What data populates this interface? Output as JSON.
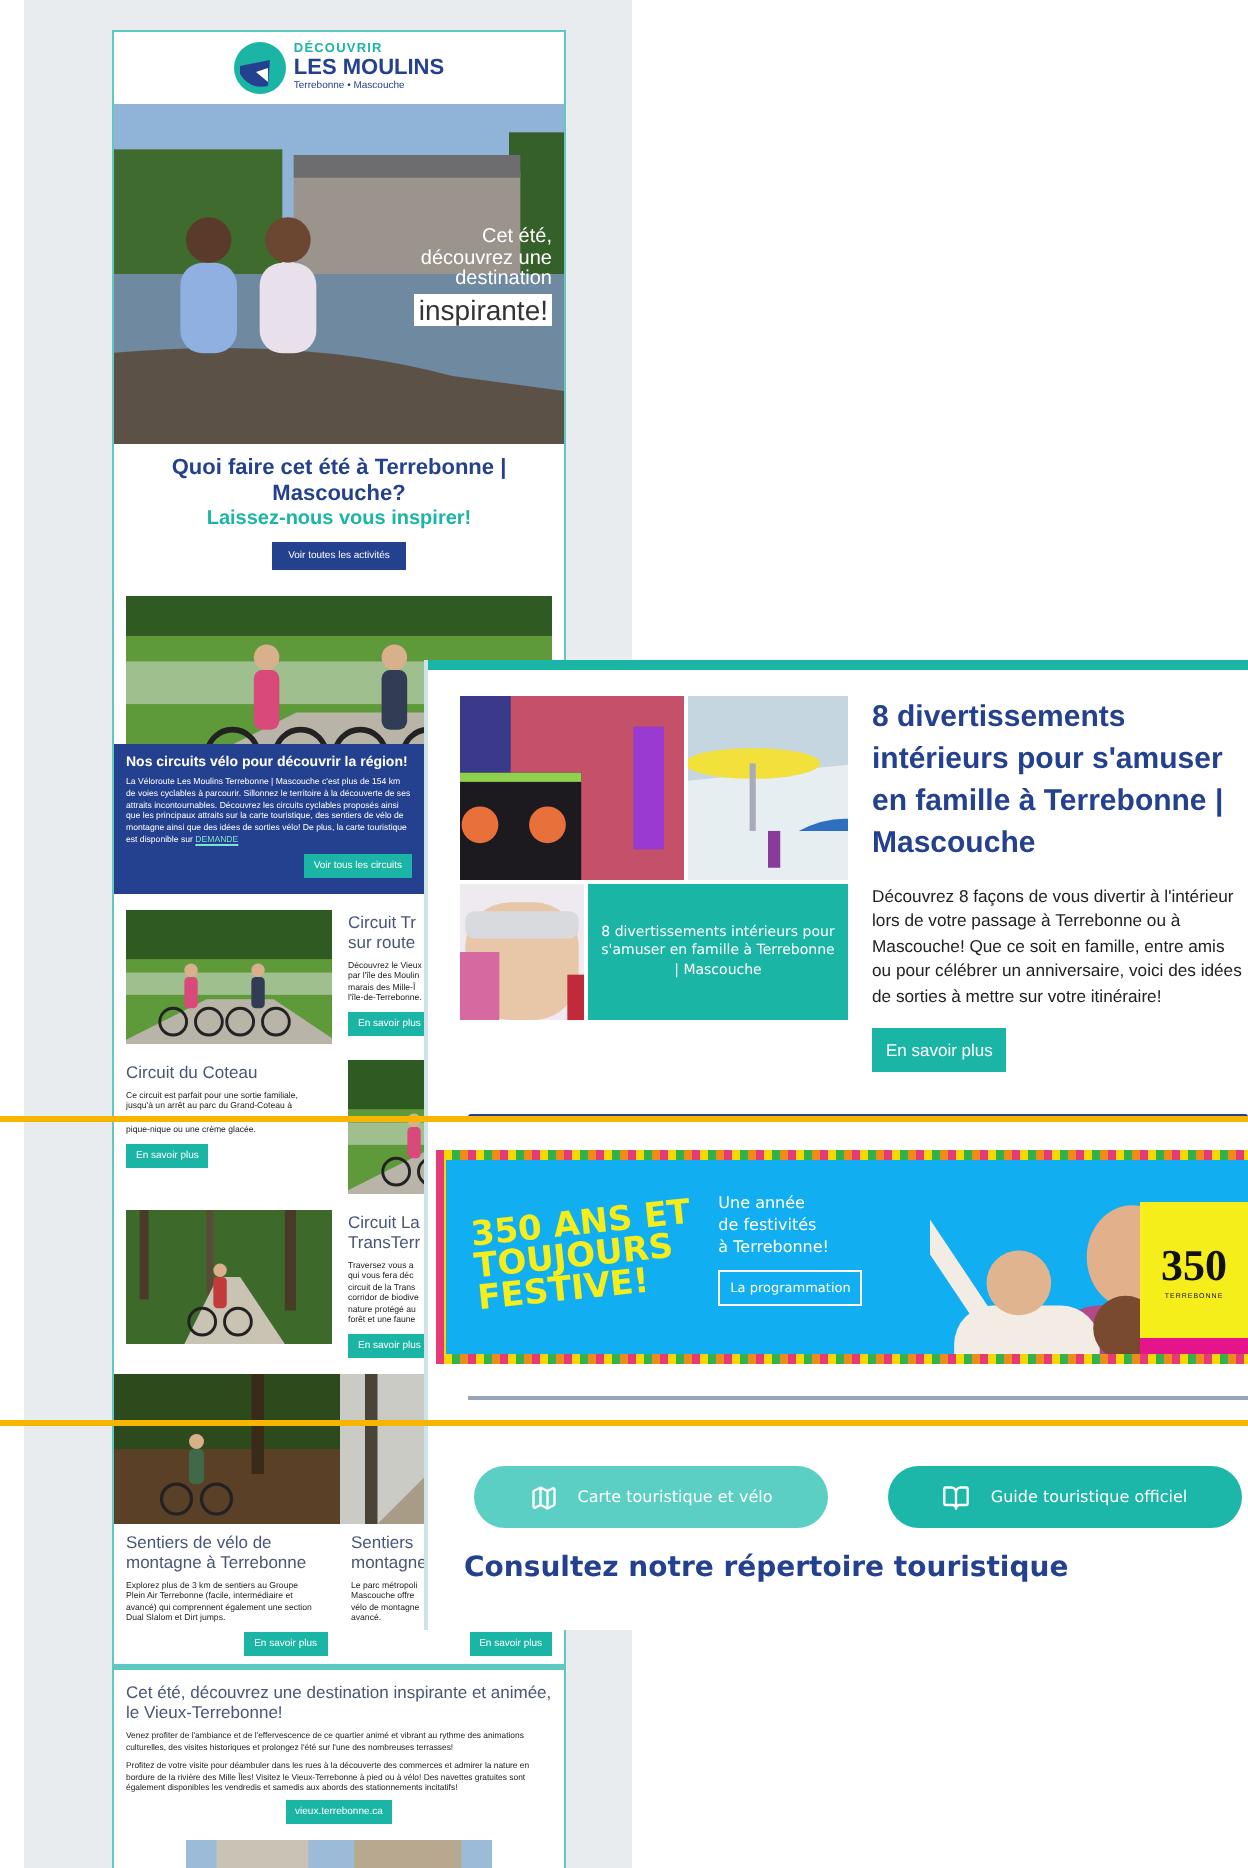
{
  "email": {
    "logo": {
      "top": "DÉCOUVRIR",
      "main": "LES MOULINS",
      "sub": "Terrebonne • Mascouche"
    },
    "hero": {
      "lines": [
        "Cet été,",
        "découvrez une",
        "destination"
      ],
      "highlight": "inspirante!"
    },
    "intro": {
      "title": "Quoi faire cet été à Terrebonne | Mascouche?",
      "subtitle": "Laissez-nous vous inspirer!",
      "button": "Voir toutes les activités"
    },
    "bike": {
      "title": "Nos circuits vélo pour découvrir la région!",
      "text": "La Véloroute Les Moulins Terrebonne | Mascouche c'est plus de 154 km de voies cyclables à parcourir. Sillonnez le territoire à la découverte de ses attraits incontournables. Découvrez les circuits cyclables proposés ainsi que les principaux attraits sur la carte touristique, des sentiers de vélo de montagne ainsi que des idées de sorties vélo! De plus, la carte touristique est disponible sur",
      "link": "DEMANDE",
      "button": "Voir tous les circuits"
    },
    "rows": [
      {
        "kind": "image-left",
        "title": [
          "Circuit Tr",
          "sur route"
        ],
        "text": [
          "Découvrez le Vieux",
          "par l'île des Moulin",
          "marais des Mille-Î",
          "l'île-de-Terrebonne."
        ],
        "button": "En savoir plus"
      },
      {
        "kind": "image-right",
        "title": [
          "Circuit du Coteau"
        ],
        "text": [
          "Ce circuit est parfait pour une sortie familiale,",
          "jusqu'à un arrêt au parc du Grand-Coteau à",
          "pique-nique ou une crème glacée."
        ],
        "button": "En savoir plus"
      },
      {
        "kind": "image-left",
        "title": [
          "Circuit La",
          "TransTerr"
        ],
        "text": [
          "Traversez vous a",
          "qui vous fera déc",
          "circuit de la Trans",
          "corridor de biodive",
          "nature protégé au",
          "forêt et une faune"
        ],
        "button": "En savoir plus"
      }
    ],
    "mountain": [
      {
        "title": [
          "Sentiers de vélo de",
          "montagne à Terrebonne"
        ],
        "text": [
          "Explorez plus de 3 km de sentiers au Groupe",
          "Plein Air Terrebonne (facile, intermédiaire et",
          "avancé) qui comprennent également une section",
          "Dual Slalom et Dirt jumps."
        ],
        "button": "En savoir plus"
      },
      {
        "title": [
          "Sentiers",
          "montagne"
        ],
        "text": [
          "Le parc métropoli",
          "Mascouche offre",
          "vélo de montagne",
          "avancé."
        ],
        "button": "En savoir plus"
      }
    ],
    "village": {
      "title": "Cet été, découvrez une destination inspirante et animée, le Vieux-Terrebonne!",
      "paragraphs": [
        "Venez profiter de l'ambiance et de l'effervescence de ce quartier animé et vibrant au rythme des animations culturelles, des visites historiques et prolongez l'été sur l'une des nombreuses terrasses!",
        "Profitez de votre visite pour déambuler dans les rues à la découverte des commerces et admirer la nature en bordure de la rivière des Mille Îles! Visitez le Vieux-Terrebonne à pied ou à vélo! Des navettes gratuites sont également disponibles les vendredis et samedis aux abords des stationnements incitatifs!"
      ],
      "button": "vieux.terrebonne.ca"
    }
  },
  "overlay": {
    "tile": "8 divertissements intérieurs pour s'amuser en famille à Terrebonne | Mascouche",
    "title": "8 divertissements intérieurs pour s'amuser en famille à Terrebonne | Mascouche",
    "text": "Découvrez 8 façons de vous divertir à l'intérieur lors de votre passage à Terrebonne ou à Mascouche! Que ce soit en famille, entre amis ou pour célébrer un anniversaire, voici des idées de sorties à mettre sur votre itinéraire!",
    "button": "En savoir plus",
    "banner": {
      "headline": [
        "350 ANS ET",
        "TOUJOURS",
        "FESTIVE!"
      ],
      "tagline": [
        "Une année",
        "de festivités",
        "à Terrebonne!"
      ],
      "button": "La programmation",
      "logo": "350",
      "logo_sub": "TERREBONNE"
    },
    "links": [
      {
        "kind": "map",
        "label": "Carte touristique et vélo"
      },
      {
        "kind": "guide",
        "label": "Guide touristique officiel"
      }
    ],
    "directory": "Consultez notre répertoire touristique"
  }
}
